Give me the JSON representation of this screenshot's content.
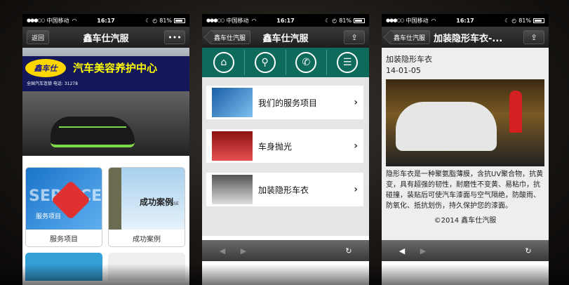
{
  "status": {
    "carrier": "中国移动",
    "time": "16:17",
    "battery": "81%"
  },
  "phone1": {
    "back": "返回",
    "title": "鑫车仕汽服",
    "more": "•••",
    "banner": {
      "logo": "鑫车仕",
      "sign": "汽车美容养护中心",
      "sub": "全国汽车连锁   电话: 31278"
    },
    "tiles": [
      {
        "label": "服务项目",
        "img_text": "SERVICE",
        "img_sub": "服务项目"
      },
      {
        "label": "成功案例",
        "img_text": "成功案例",
        "img_sub": "CASE"
      }
    ]
  },
  "phone2": {
    "back": "鑫车仕汽服",
    "title": "鑫车仕汽服",
    "icons": [
      "home-icon",
      "location-icon",
      "phone-icon",
      "list-icon"
    ],
    "items": [
      {
        "text": "我们的服务项目"
      },
      {
        "text": "车身抛光"
      },
      {
        "text": "加装隐形车衣"
      }
    ]
  },
  "phone3": {
    "back": "鑫车仕汽服",
    "title": "加装隐形车衣-...",
    "article": {
      "title": "加装隐形车衣",
      "date": "14-01-05",
      "body": "隐形车衣是一种聚氨脂薄膜，含抗UV聚合物，抗黄变，具有超强的韧性，耐磨性不变黄、易粘巾，抗碰撞，装贴后可使汽车漆面与空气隔绝，防酸雨、防氧化、抵抗划伤，持久保护您的漆面。",
      "copyright": "©2014 鑫车仕汽服"
    }
  },
  "colors": {
    "teal": "#0e6a5a",
    "nav_dark": "#1e1e1e"
  }
}
